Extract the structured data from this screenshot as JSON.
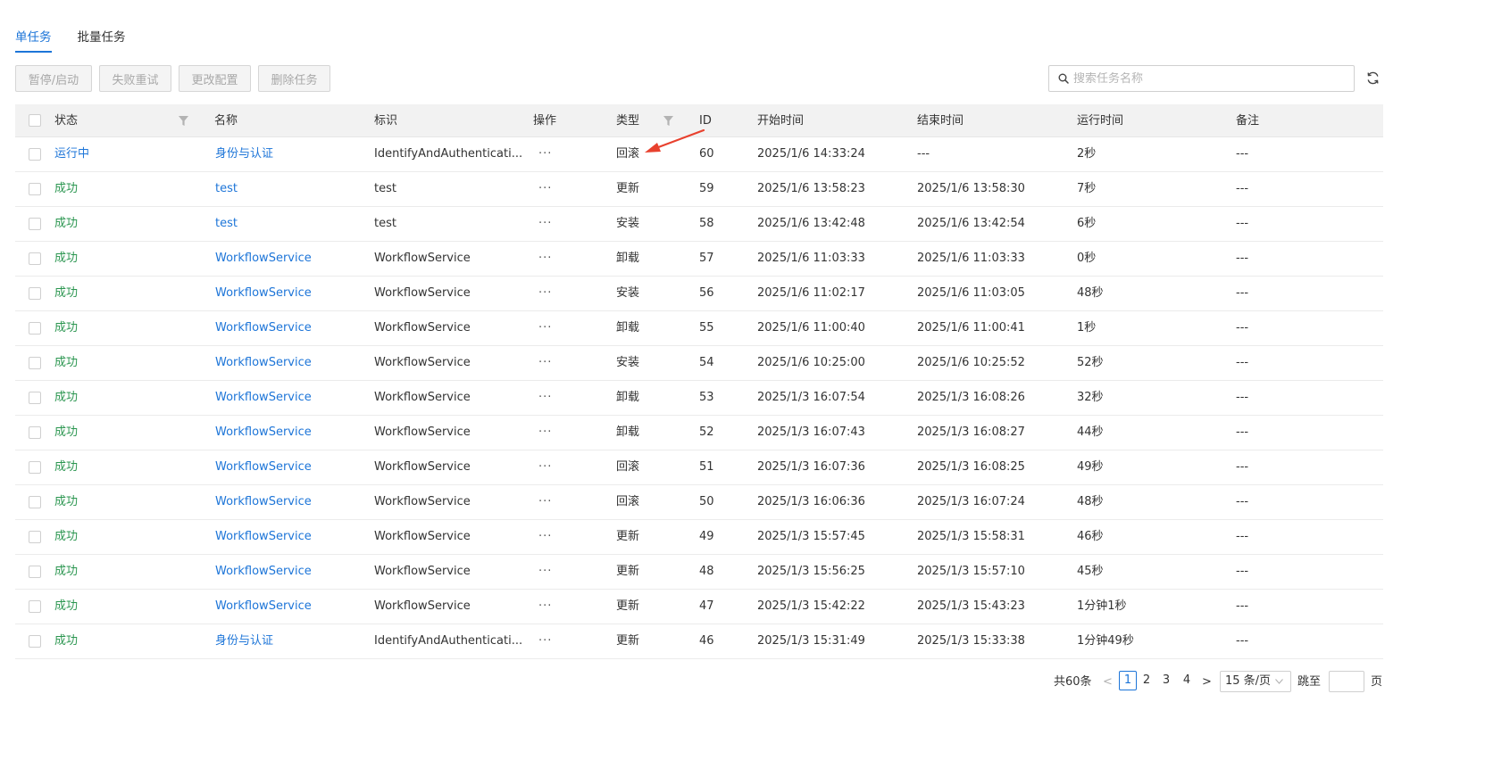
{
  "tabs": [
    {
      "label": "单任务",
      "active": true
    },
    {
      "label": "批量任务",
      "active": false
    }
  ],
  "toolbar": {
    "pause_start": "暂停/启动",
    "retry_failed": "失败重试",
    "change_config": "更改配置",
    "delete_task": "删除任务"
  },
  "search": {
    "placeholder": "搜索任务名称",
    "icon": "search-icon"
  },
  "refresh_icon": "refresh-icon",
  "table": {
    "headers": {
      "status": "状态",
      "name": "名称",
      "identifier": "标识",
      "action": "操作",
      "type": "类型",
      "id": "ID",
      "start_time": "开始时间",
      "end_time": "结束时间",
      "run_time": "运行时间",
      "remark": "备注"
    },
    "rows": [
      {
        "status": "运行中",
        "status_kind": "running",
        "name": "身份与认证",
        "identifier": "IdentifyAndAuthenticati...",
        "action": "···",
        "type": "回滚",
        "id": "60",
        "start": "2025/1/6 14:33:24",
        "end": "---",
        "duration": "2秒",
        "remark": "---"
      },
      {
        "status": "成功",
        "status_kind": "success",
        "name": "test",
        "identifier": "test",
        "action": "···",
        "type": "更新",
        "id": "59",
        "start": "2025/1/6 13:58:23",
        "end": "2025/1/6 13:58:30",
        "duration": "7秒",
        "remark": "---"
      },
      {
        "status": "成功",
        "status_kind": "success",
        "name": "test",
        "identifier": "test",
        "action": "···",
        "type": "安装",
        "id": "58",
        "start": "2025/1/6 13:42:48",
        "end": "2025/1/6 13:42:54",
        "duration": "6秒",
        "remark": "---"
      },
      {
        "status": "成功",
        "status_kind": "success",
        "name": "WorkflowService",
        "identifier": "WorkflowService",
        "action": "···",
        "type": "卸载",
        "id": "57",
        "start": "2025/1/6 11:03:33",
        "end": "2025/1/6 11:03:33",
        "duration": "0秒",
        "remark": "---"
      },
      {
        "status": "成功",
        "status_kind": "success",
        "name": "WorkflowService",
        "identifier": "WorkflowService",
        "action": "···",
        "type": "安装",
        "id": "56",
        "start": "2025/1/6 11:02:17",
        "end": "2025/1/6 11:03:05",
        "duration": "48秒",
        "remark": "---"
      },
      {
        "status": "成功",
        "status_kind": "success",
        "name": "WorkflowService",
        "identifier": "WorkflowService",
        "action": "···",
        "type": "卸载",
        "id": "55",
        "start": "2025/1/6 11:00:40",
        "end": "2025/1/6 11:00:41",
        "duration": "1秒",
        "remark": "---"
      },
      {
        "status": "成功",
        "status_kind": "success",
        "name": "WorkflowService",
        "identifier": "WorkflowService",
        "action": "···",
        "type": "安装",
        "id": "54",
        "start": "2025/1/6 10:25:00",
        "end": "2025/1/6 10:25:52",
        "duration": "52秒",
        "remark": "---"
      },
      {
        "status": "成功",
        "status_kind": "success",
        "name": "WorkflowService",
        "identifier": "WorkflowService",
        "action": "···",
        "type": "卸载",
        "id": "53",
        "start": "2025/1/3 16:07:54",
        "end": "2025/1/3 16:08:26",
        "duration": "32秒",
        "remark": "---"
      },
      {
        "status": "成功",
        "status_kind": "success",
        "name": "WorkflowService",
        "identifier": "WorkflowService",
        "action": "···",
        "type": "卸载",
        "id": "52",
        "start": "2025/1/3 16:07:43",
        "end": "2025/1/3 16:08:27",
        "duration": "44秒",
        "remark": "---"
      },
      {
        "status": "成功",
        "status_kind": "success",
        "name": "WorkflowService",
        "identifier": "WorkflowService",
        "action": "···",
        "type": "回滚",
        "id": "51",
        "start": "2025/1/3 16:07:36",
        "end": "2025/1/3 16:08:25",
        "duration": "49秒",
        "remark": "---"
      },
      {
        "status": "成功",
        "status_kind": "success",
        "name": "WorkflowService",
        "identifier": "WorkflowService",
        "action": "···",
        "type": "回滚",
        "id": "50",
        "start": "2025/1/3 16:06:36",
        "end": "2025/1/3 16:07:24",
        "duration": "48秒",
        "remark": "---"
      },
      {
        "status": "成功",
        "status_kind": "success",
        "name": "WorkflowService",
        "identifier": "WorkflowService",
        "action": "···",
        "type": "更新",
        "id": "49",
        "start": "2025/1/3 15:57:45",
        "end": "2025/1/3 15:58:31",
        "duration": "46秒",
        "remark": "---"
      },
      {
        "status": "成功",
        "status_kind": "success",
        "name": "WorkflowService",
        "identifier": "WorkflowService",
        "action": "···",
        "type": "更新",
        "id": "48",
        "start": "2025/1/3 15:56:25",
        "end": "2025/1/3 15:57:10",
        "duration": "45秒",
        "remark": "---"
      },
      {
        "status": "成功",
        "status_kind": "success",
        "name": "WorkflowService",
        "identifier": "WorkflowService",
        "action": "···",
        "type": "更新",
        "id": "47",
        "start": "2025/1/3 15:42:22",
        "end": "2025/1/3 15:43:23",
        "duration": "1分钟1秒",
        "remark": "---"
      },
      {
        "status": "成功",
        "status_kind": "success",
        "name": "身份与认证",
        "identifier": "IdentifyAndAuthenticati...",
        "action": "···",
        "type": "更新",
        "id": "46",
        "start": "2025/1/3 15:31:49",
        "end": "2025/1/3 15:33:38",
        "duration": "1分钟49秒",
        "remark": "---"
      }
    ]
  },
  "pagination": {
    "total": "共60条",
    "prev": "<",
    "pages": [
      "1",
      "2",
      "3",
      "4"
    ],
    "current": "1",
    "next": ">",
    "page_size": "15 条/页",
    "jump_label": "跳至",
    "page_suffix": "页"
  },
  "colors": {
    "accent": "#1d75d8",
    "success": "#2b9650",
    "annotation_arrow": "#e8412e"
  }
}
